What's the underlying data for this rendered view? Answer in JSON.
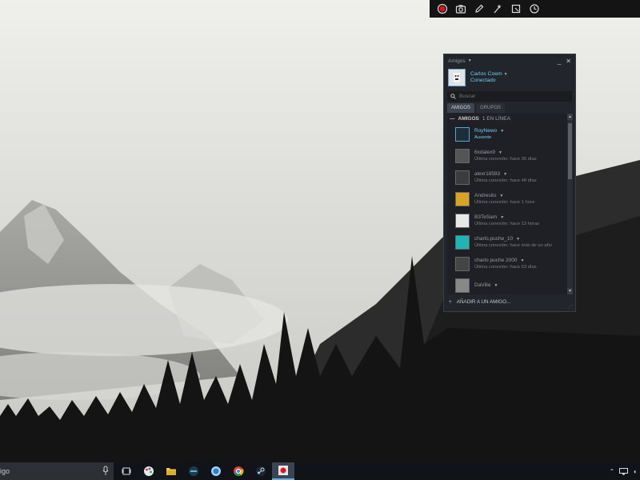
{
  "recording_toolbar": {
    "buttons": [
      {
        "icon": "record-icon",
        "color": "#e81123"
      },
      {
        "icon": "camera-icon"
      },
      {
        "icon": "pencil-icon"
      },
      {
        "icon": "effects-icon"
      },
      {
        "icon": "crop-icon"
      },
      {
        "icon": "clock-icon"
      }
    ]
  },
  "friends_window": {
    "menu_label": "Amigos",
    "user": {
      "name": "Carlos Coem",
      "status": "Conectado"
    },
    "search": {
      "placeholder": "Buscar"
    },
    "tabs": [
      "AMIGOS",
      "GRUPOS"
    ],
    "group": {
      "label": "AMIGOS",
      "count": "1 EN LÍNEA",
      "toggle": "—"
    },
    "friends": [
      {
        "name": "RoyNewo",
        "status": "Ausente",
        "online": true,
        "avatar_color": "#1b2e3a"
      },
      {
        "name": "6xdalex9",
        "status": "Última conexión: hace 35 días",
        "online": false,
        "avatar_color": "#555555"
      },
      {
        "name": "alexr18593",
        "status": "Última conexión: hace 48 días",
        "online": false,
        "avatar_color": "#3c3c3c"
      },
      {
        "name": "Andresito",
        "status": "Última conexión: hace 1 hora",
        "online": false,
        "avatar_color": "#d9a520"
      },
      {
        "name": "B3TeSam",
        "status": "Última conexión: hace 13 horas",
        "online": false,
        "avatar_color": "#e8e8e8"
      },
      {
        "name": "charlo.puche_10",
        "status": "Última conexión: hace más de un año",
        "online": false,
        "avatar_color": "#1fb5b5"
      },
      {
        "name": "charlo puche 2000",
        "status": "Última conexión: hace 63 días",
        "online": false,
        "avatar_color": "#444444"
      },
      {
        "name": "DaVille",
        "status": "",
        "online": false,
        "avatar_color": "#888888"
      }
    ],
    "add_friend_label": "AÑADIR A UN AMIGO..."
  },
  "taskbar": {
    "search_value": "igo",
    "icons": [
      "task-view-icon",
      "paint-icon",
      "file-explorer-icon",
      "app-icon",
      "ie-icon",
      "chrome-icon",
      "steam-icon",
      "recorder-icon"
    ]
  },
  "colors": {
    "accent": "#6dcff6",
    "panel_bg": "#22252b",
    "taskbar_bg": "#101317"
  }
}
